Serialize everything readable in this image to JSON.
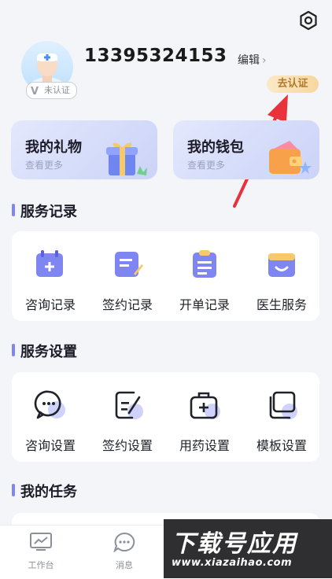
{
  "profile": {
    "phone": "13395324153",
    "edit_label": "编辑",
    "badge": "未认证",
    "verify_label": "去认证"
  },
  "cards": [
    {
      "title": "我的礼物",
      "subtitle": "查看更多"
    },
    {
      "title": "我的钱包",
      "subtitle": "查看更多"
    }
  ],
  "service_records": {
    "title": "服务记录",
    "items": [
      {
        "label": "咨询记录",
        "icon": "calendar-plus-icon"
      },
      {
        "label": "签约记录",
        "icon": "signed-document-icon"
      },
      {
        "label": "开单记录",
        "icon": "clipboard-icon"
      },
      {
        "label": "医生服务",
        "icon": "smile-box-icon"
      }
    ]
  },
  "service_settings": {
    "title": "服务设置",
    "items": [
      {
        "label": "咨询设置",
        "icon": "chat-bubble-icon"
      },
      {
        "label": "签约设置",
        "icon": "edit-document-icon"
      },
      {
        "label": "用药设置",
        "icon": "medicine-kit-icon"
      },
      {
        "label": "模板设置",
        "icon": "layers-icon"
      }
    ]
  },
  "my_tasks": {
    "title": "我的任务"
  },
  "bottom_nav": [
    {
      "label": "工作台",
      "icon": "dashboard-icon"
    },
    {
      "label": "消息",
      "icon": "message-icon"
    }
  ],
  "watermark": {
    "main": "下载号应用",
    "url": "www.xiazaihao.com"
  },
  "colors": {
    "accent": "#7f86f2",
    "verify_text": "#b07a2b",
    "arrow": "#e8323c"
  }
}
